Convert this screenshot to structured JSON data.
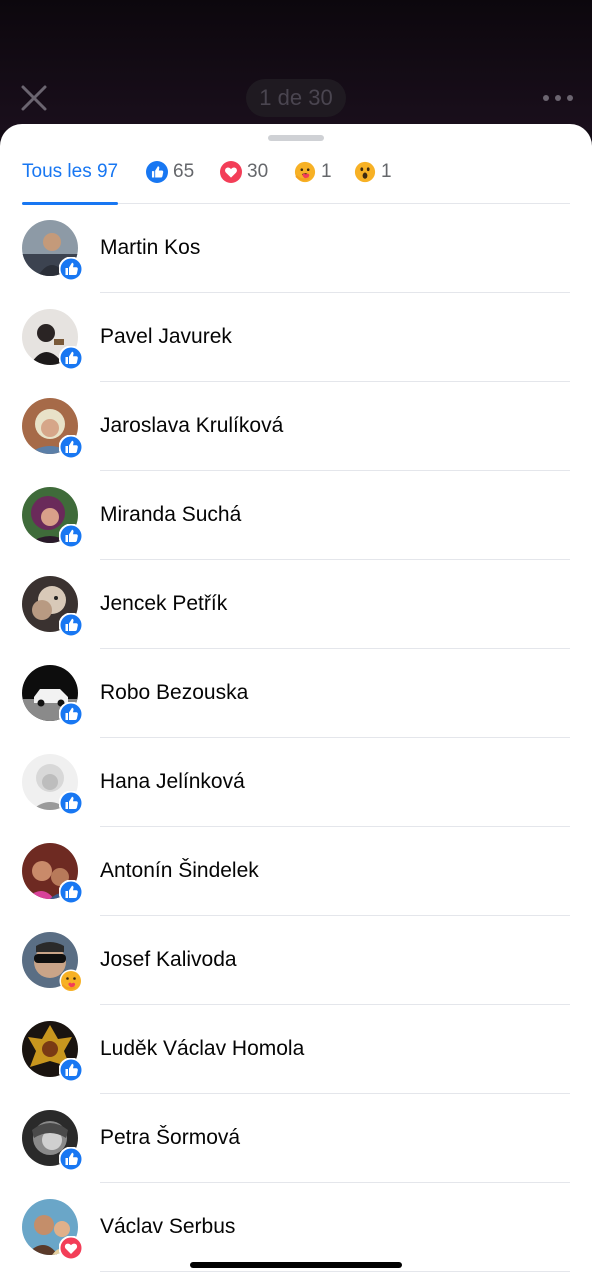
{
  "header": {
    "counter": "1 de 30",
    "close_icon": "close-icon",
    "more_icon": "more-horizontal-icon"
  },
  "tabs": [
    {
      "label": "Tous les 97",
      "icon": null,
      "active": true
    },
    {
      "label": "65",
      "icon": "like-icon",
      "active": false
    },
    {
      "label": "30",
      "icon": "love-icon",
      "active": false
    },
    {
      "label": "1",
      "icon": "care-icon",
      "active": false
    },
    {
      "label": "1",
      "icon": "wow-icon",
      "active": false
    }
  ],
  "people": [
    {
      "name": "Martin Kos",
      "reaction": "like"
    },
    {
      "name": "Pavel Javurek",
      "reaction": "like"
    },
    {
      "name": "Jaroslava Krulíková",
      "reaction": "like"
    },
    {
      "name": "Miranda Suchá",
      "reaction": "like"
    },
    {
      "name": "Jencek Petřík",
      "reaction": "like"
    },
    {
      "name": "Robo Bezouska",
      "reaction": "like"
    },
    {
      "name": "Hana Jelínková",
      "reaction": "like"
    },
    {
      "name": "Antonín Šindelek",
      "reaction": "like"
    },
    {
      "name": "Josef Kalivoda",
      "reaction": "care"
    },
    {
      "name": "Luděk Václav Homola",
      "reaction": "like"
    },
    {
      "name": "Petra Šormová",
      "reaction": "like"
    },
    {
      "name": "Václav Serbus",
      "reaction": "love"
    }
  ],
  "colors": {
    "accent": "#1877f2",
    "love": "#f33e58",
    "care": "#f7b125"
  }
}
